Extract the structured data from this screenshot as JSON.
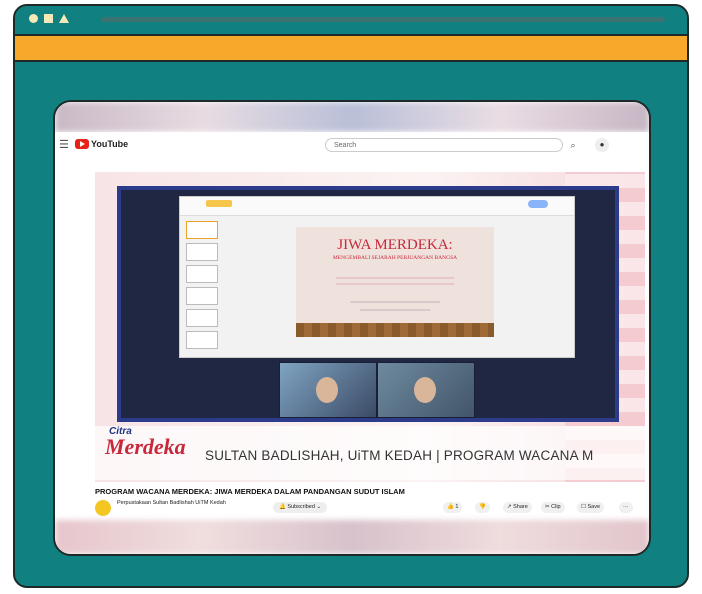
{
  "youtube": {
    "logo_text": "YouTube",
    "search_placeholder": "Search",
    "search_icon": "search-icon",
    "mic_icon": "mic-icon",
    "menu_icon": "menu-icon"
  },
  "slide": {
    "title": "JIWA MERDEKA:",
    "subtitle": "MENGEMBALI SEJARAH PERJUANGAN BANGSA"
  },
  "banner": {
    "logo_script": "Merdeka",
    "logo_top": "Citra",
    "scroll_text": "SULTAN BADLISHAH, UiTM KEDAH | PROGRAM WACANA M"
  },
  "video": {
    "title": "PROGRAM WACANA MERDEKA: JIWA MERDEKA DALAM PANDANGAN SUDUT ISLAM",
    "channel_name": "Perpustakaan Sultan Badlishah UiTM Kedah",
    "subscribe_label": "Subscribed",
    "like_count": "1",
    "share_label": "Share",
    "clip_label": "Clip",
    "save_label": "Save",
    "more_label": "···"
  },
  "colors": {
    "frame": "#118080",
    "accent": "#f6a92b",
    "youtube_red": "#e62117"
  }
}
